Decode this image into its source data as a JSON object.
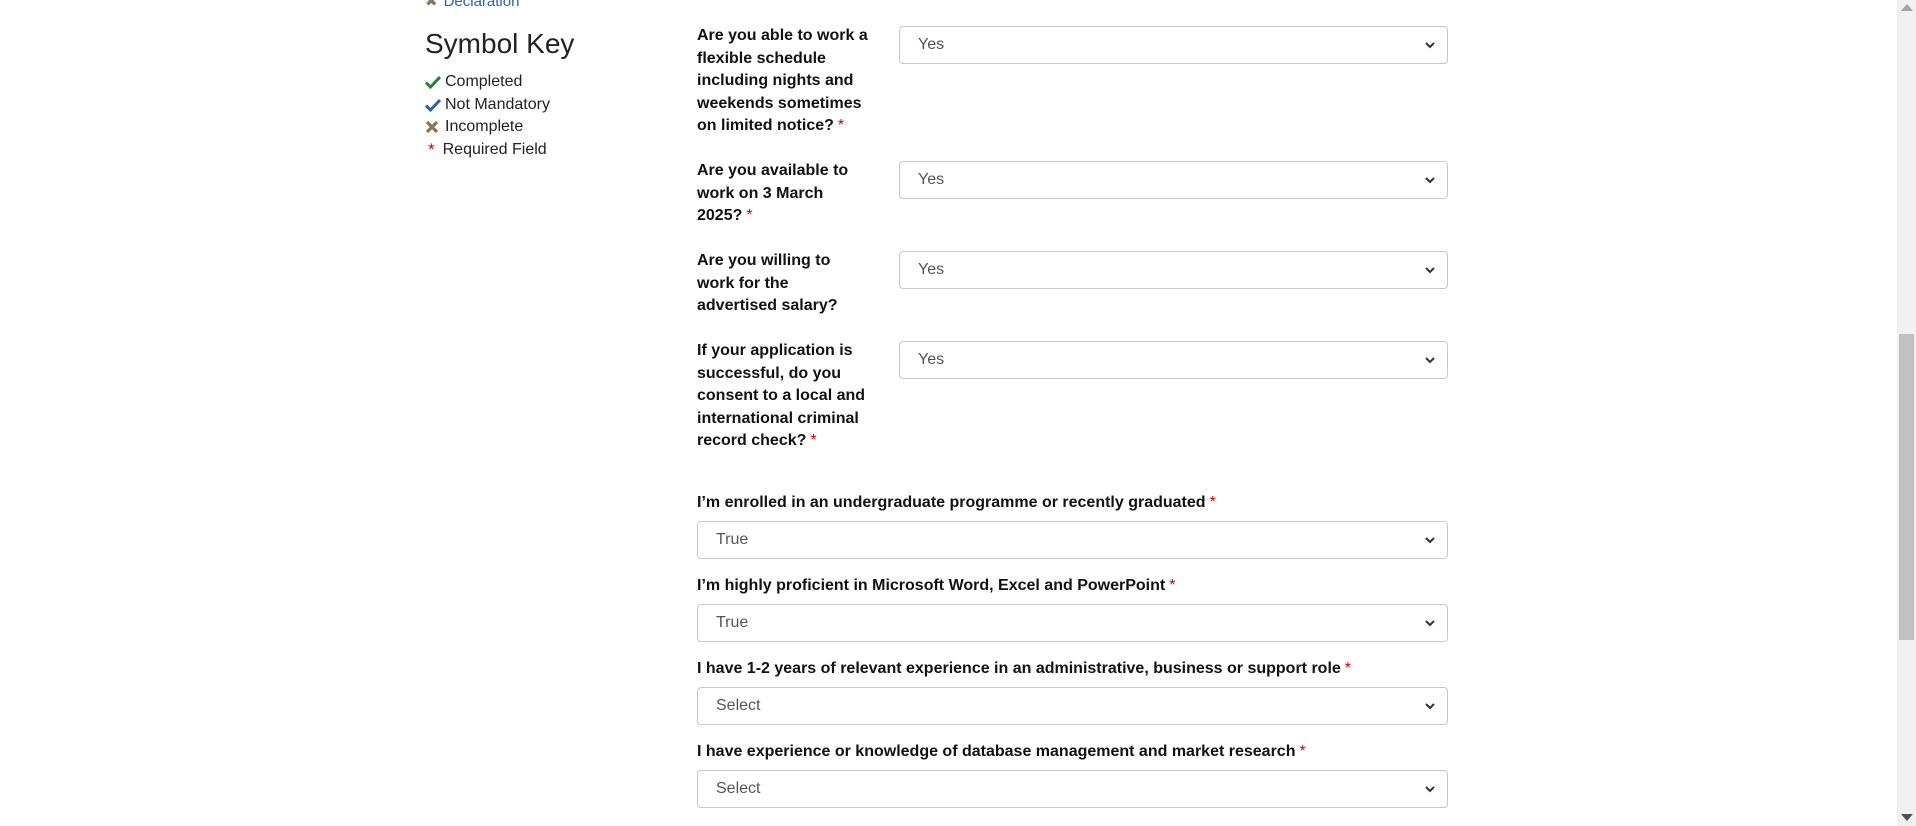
{
  "colors": {
    "completed": "#2e7d32",
    "not_mandatory": "#2a6496",
    "incomplete": "#8b7355",
    "required": "#cc0000"
  },
  "nav": {
    "partial_link": "Declaration",
    "partial_link_icon": "cross-icon"
  },
  "symbol_key": {
    "title": "Symbol Key",
    "items": [
      {
        "icon": "check-icon",
        "label": "Completed"
      },
      {
        "icon": "check-icon",
        "label": "Not Mandatory"
      },
      {
        "icon": "cross-icon",
        "label": "Incomplete"
      },
      {
        "icon": "asterisk-icon",
        "symbol": "*",
        "label": "Required Field"
      }
    ]
  },
  "form": {
    "questions": [
      {
        "label": "Are you able to work a flexible schedule including nights and weekends sometimes on limited notice?",
        "required_mark": "*",
        "value": "Yes"
      },
      {
        "label": "Are you available to work on 3 March 2025?",
        "required_mark": "*",
        "value": "Yes"
      },
      {
        "label": "Are you willing to work for the advertised salary?",
        "required_mark": "",
        "value": "Yes"
      },
      {
        "label": "If your application is successful, do you consent to a local and international criminal record check?",
        "required_mark": "*",
        "value": "Yes"
      },
      {
        "label": "I’m enrolled in an undergraduate programme or recently graduated",
        "required_mark": "*",
        "value": "True"
      },
      {
        "label": "I’m highly proficient in Microsoft Word, Excel and PowerPoint",
        "required_mark": "*",
        "value": "True"
      },
      {
        "label": "I have 1-2 years of relevant experience in an administrative, business or support role",
        "required_mark": "*",
        "value": "Select"
      },
      {
        "label": "I have experience or knowledge of database management and market research",
        "required_mark": "*",
        "value": "Select"
      }
    ]
  }
}
